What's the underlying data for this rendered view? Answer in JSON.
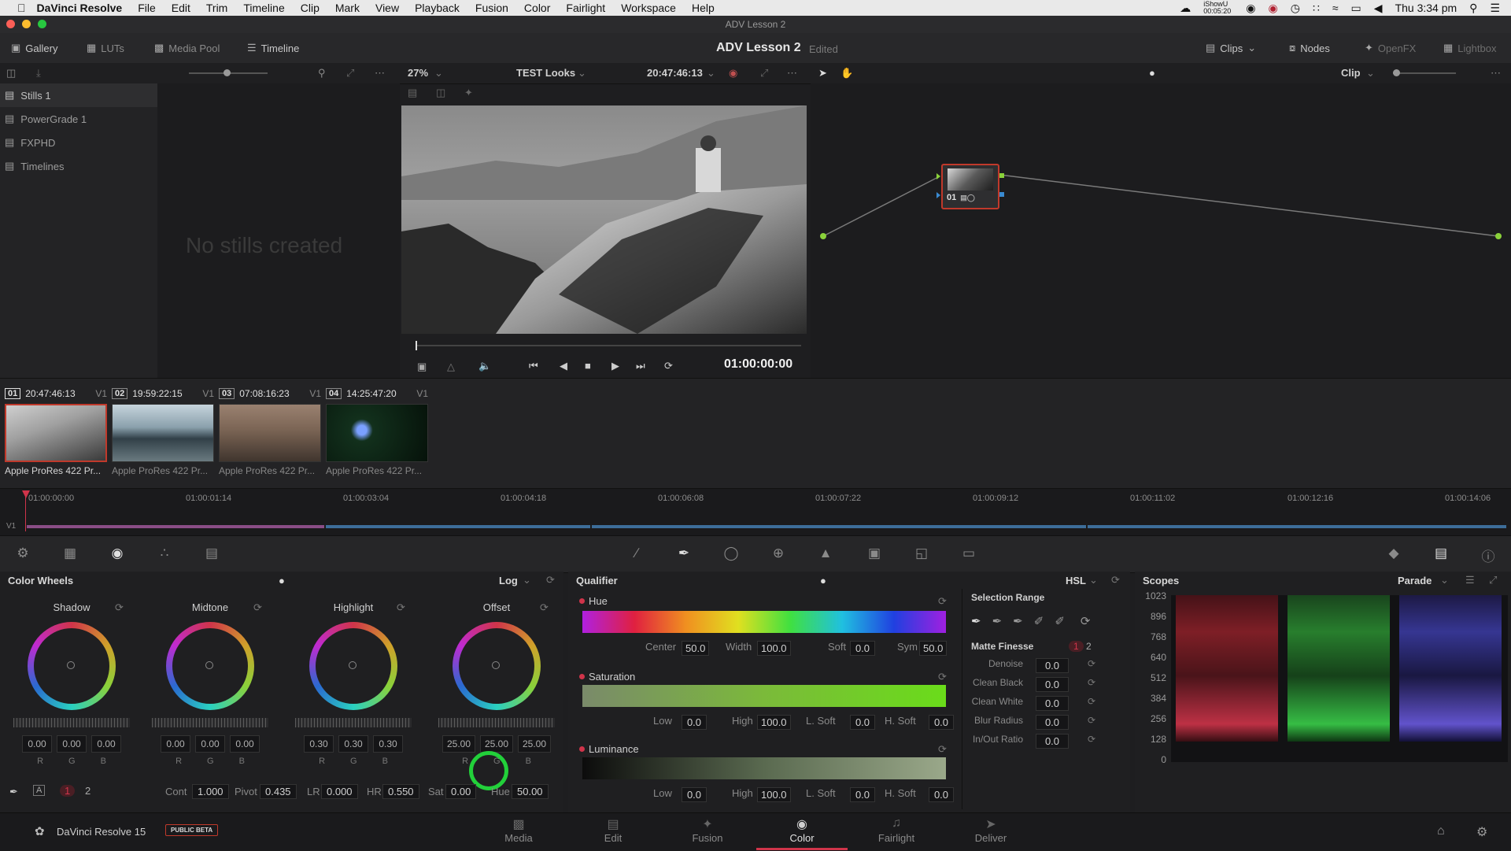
{
  "menubar": {
    "app": "DaVinci Resolve",
    "menus": [
      "File",
      "Edit",
      "Trim",
      "Timeline",
      "Clip",
      "Mark",
      "View",
      "Playback",
      "Fusion",
      "Color",
      "Fairlight",
      "Workspace",
      "Help"
    ],
    "status_text": "iShowU 00:05:20",
    "clock": "Thu 3:34 pm"
  },
  "window": {
    "title": "ADV Lesson 2"
  },
  "toolbar": {
    "gallery": "Gallery",
    "luts": "LUTs",
    "media_pool": "Media Pool",
    "timeline": "Timeline",
    "project_title": "ADV Lesson 2",
    "project_status": "Edited",
    "clips": "Clips",
    "nodes": "Nodes",
    "openfx": "OpenFX",
    "lightbox": "Lightbox"
  },
  "subbar": {
    "zoom": "27%",
    "timeline_name": "TEST Looks",
    "timecode": "20:47:46:13",
    "node_mode": "Clip"
  },
  "gallery": {
    "items": [
      "Stills 1",
      "PowerGrade 1",
      "FXPHD",
      "Timelines"
    ],
    "empty_message": "No stills created"
  },
  "viewer": {
    "timecode": "01:00:00:00"
  },
  "nodes": {
    "node_label": "01"
  },
  "clips": [
    {
      "num": "01",
      "tc": "20:47:46:13",
      "track": "V1",
      "name": "Apple ProRes 422 Pr...",
      "colors": [
        "#cfcfcf",
        "#3a3a3a"
      ]
    },
    {
      "num": "02",
      "tc": "19:59:22:15",
      "track": "V1",
      "name": "Apple ProRes 422 Pr...",
      "colors": [
        "#c6d4dc",
        "#314048"
      ]
    },
    {
      "num": "03",
      "tc": "07:08:16:23",
      "track": "V1",
      "name": "Apple ProRes 422 Pr...",
      "colors": [
        "#9a8170",
        "#40352e"
      ]
    },
    {
      "num": "04",
      "tc": "14:25:47:20",
      "track": "V1",
      "name": "Apple ProRes 422 Pr...",
      "colors": [
        "#12301c",
        "#06120a"
      ]
    }
  ],
  "mini_timeline": {
    "ticks": [
      "01:00:00:00",
      "01:00:01:14",
      "01:00:03:04",
      "01:00:04:18",
      "01:00:06:08",
      "01:00:07:22",
      "01:00:09:12",
      "01:00:11:02",
      "01:00:12:16",
      "01:00:14:06"
    ],
    "track": "V1"
  },
  "color_wheels": {
    "title": "Color Wheels",
    "mode": "Log",
    "wheels": [
      {
        "label": "Shadow",
        "values": [
          "0.00",
          "0.00",
          "0.00"
        ]
      },
      {
        "label": "Midtone",
        "values": [
          "0.00",
          "0.00",
          "0.00"
        ]
      },
      {
        "label": "Highlight",
        "values": [
          "0.30",
          "0.30",
          "0.30"
        ]
      },
      {
        "label": "Offset",
        "values": [
          "25.00",
          "25.00",
          "25.00"
        ]
      }
    ],
    "channel_labels": [
      "R",
      "G",
      "B"
    ],
    "pages": [
      "1",
      "2"
    ],
    "params": [
      {
        "label": "Cont",
        "value": "1.000"
      },
      {
        "label": "Pivot",
        "value": "0.435"
      },
      {
        "label": "LR",
        "value": "0.000"
      },
      {
        "label": "HR",
        "value": "0.550"
      },
      {
        "label": "Sat",
        "value": "0.00"
      },
      {
        "label": "Hue",
        "value": "50.00"
      }
    ]
  },
  "qualifier": {
    "title": "Qualifier",
    "mode": "HSL",
    "hue": {
      "label": "Hue",
      "center_label": "Center",
      "center": "50.0",
      "width_label": "Width",
      "width": "100.0",
      "soft_label": "Soft",
      "soft": "0.0",
      "sym_label": "Sym",
      "sym": "50.0"
    },
    "saturation": {
      "label": "Saturation",
      "low_label": "Low",
      "low": "0.0",
      "high_label": "High",
      "high": "100.0",
      "lsoft_label": "L. Soft",
      "lsoft": "0.0",
      "hsoft_label": "H. Soft",
      "hsoft": "0.0"
    },
    "luminance": {
      "label": "Luminance",
      "low_label": "Low",
      "low": "0.0",
      "high_label": "High",
      "high": "100.0",
      "lsoft_label": "L. Soft",
      "lsoft": "0.0",
      "hsoft_label": "H. Soft",
      "hsoft": "0.0"
    },
    "selection_range": "Selection Range",
    "matte_finesse": "Matte Finesse",
    "mf_pages": [
      "1",
      "2"
    ],
    "mf_rows": [
      {
        "label": "Denoise",
        "value": "0.0"
      },
      {
        "label": "Clean Black",
        "value": "0.0"
      },
      {
        "label": "Clean White",
        "value": "0.0"
      },
      {
        "label": "Blur Radius",
        "value": "0.0"
      },
      {
        "label": "In/Out Ratio",
        "value": "0.0"
      }
    ]
  },
  "scopes": {
    "title": "Scopes",
    "mode": "Parade",
    "axis": [
      "1023",
      "896",
      "768",
      "640",
      "512",
      "384",
      "256",
      "128",
      "0"
    ]
  },
  "pagebar": {
    "app_version": "DaVinci Resolve 15",
    "beta_badge": "PUBLIC BETA",
    "pages": [
      "Media",
      "Edit",
      "Fusion",
      "Color",
      "Fairlight",
      "Deliver"
    ],
    "active_page": "Color"
  },
  "accent_colors": {
    "red": "#d0344a",
    "node_green": "#8ad13a",
    "offset_ring": "#22d03a"
  }
}
